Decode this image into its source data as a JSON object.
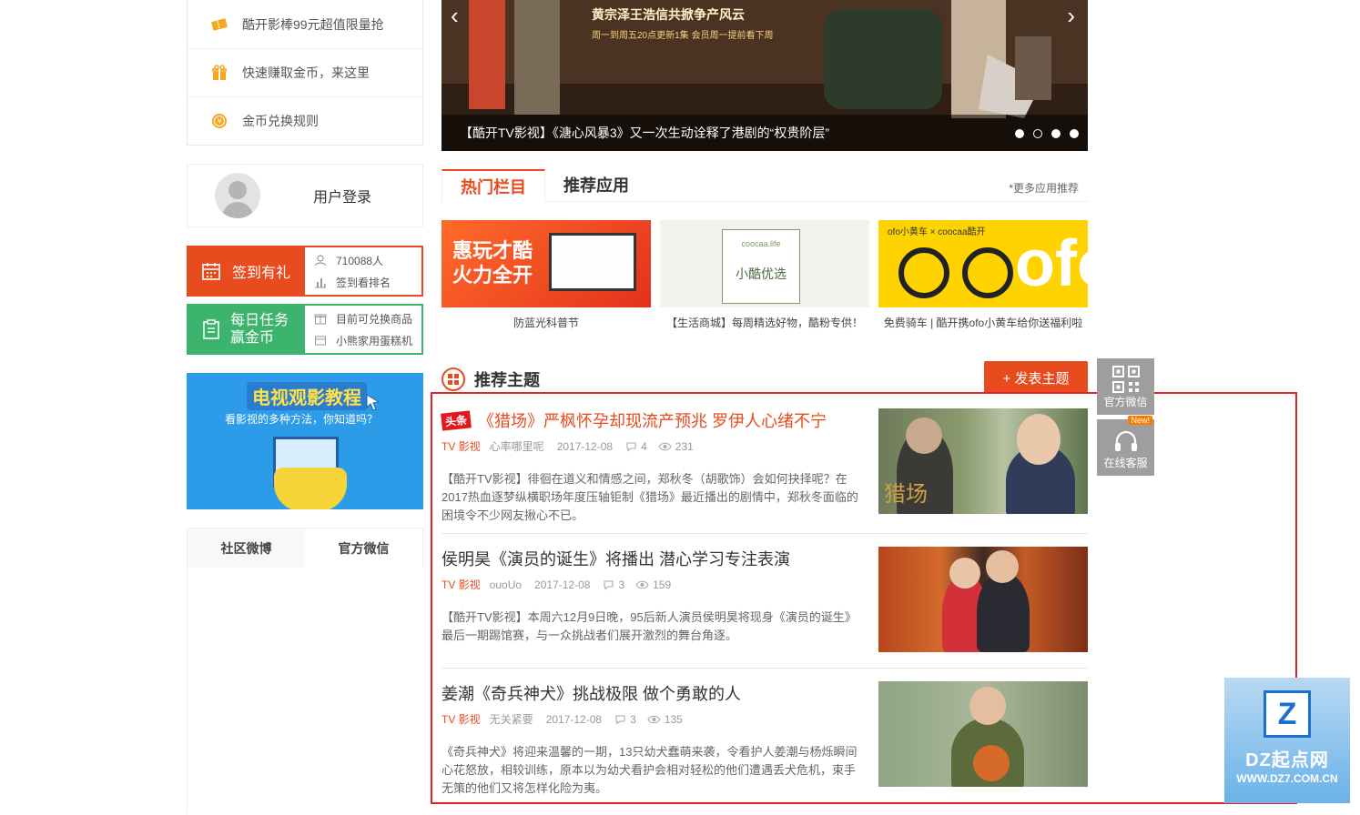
{
  "gifts": {
    "items": [
      {
        "label": "酷开影棒99元超值限量抢",
        "icon": "ticket-icon"
      },
      {
        "label": "快速赚取金币，来这里",
        "icon": "gift-icon"
      },
      {
        "label": "金币兑换规则",
        "icon": "coin-icon"
      }
    ]
  },
  "login": {
    "label": "用户登录"
  },
  "sign": {
    "label": "签到有礼",
    "count": "710088人",
    "rank": "签到看排名"
  },
  "task": {
    "line1": "每日任务",
    "line2": "赢金币",
    "item1": "目前可兑换商品",
    "item2": "小熊家用蛋糕机"
  },
  "tutorial": {
    "title": "电视观影教程",
    "subtitle": "看影视的多种方法，你知道吗？"
  },
  "social": {
    "tab1": "社区微博",
    "tab2": "官方微信"
  },
  "banner": {
    "headline": "黄宗泽王浩信共掀争产风云",
    "schedule": "周一到周五20点更新1集   会员周一提前看下周",
    "caption": "【酷开TV影视】《溏心风暴3》又一次生动诠释了港剧的“权贵阶层”"
  },
  "sections": {
    "tab_active": "热门栏目",
    "tab_other": "推荐应用",
    "more": "*更多应用推荐"
  },
  "apps": [
    {
      "label": "防蓝光科普节",
      "img_text1": "惠玩才酷",
      "img_text2": "火力全开"
    },
    {
      "label": "【生活商城】每周精选好物，酷粉专供！",
      "img_text1": "coocaa.life",
      "img_text2": "小酷优选"
    },
    {
      "label": "免费骑车 | 酷开携ofo小黄车给你送福利啦",
      "img_text1": "ofo小黄车 × coocaa酷开",
      "img_text2": "ofo"
    }
  ],
  "topics_head": {
    "title": "推荐主题",
    "post_button": "+ 发表主题"
  },
  "topics": [
    {
      "tag": "头条",
      "title": "《猎场》严枫怀孕却现流产预兆 罗伊人心绪不宁",
      "category": "TV 影视",
      "author": "心率哪里呢",
      "date": "2017-12-08",
      "replies": "4",
      "views": "231",
      "desc": "【酷开TV影视】徘徊在道义和情感之间，郑秋冬（胡歌饰）会如何抉择呢？在2017热血逐梦纵横职场年度压轴钜制《猎场》最近播出的剧情中，郑秋冬面临的困境令不少网友揪心不已。",
      "pic_text": "猎场"
    },
    {
      "title": "侯明昊《演员的诞生》将播出 潜心学习专注表演",
      "category": "TV 影视",
      "author": "ouoUo",
      "date": "2017-12-08",
      "replies": "3",
      "views": "159",
      "desc": "【酷开TV影视】本周六12月9日晚，95后新人演员侯明昊将现身《演员的诞生》最后一期踢馆赛，与一众挑战者们展开激烈的舞台角逐。"
    },
    {
      "title": "姜潮《奇兵神犬》挑战极限 做个勇敢的人",
      "category": "TV 影视",
      "author": "无关紧要",
      "date": "2017-12-08",
      "replies": "3",
      "views": "135",
      "desc": "《奇兵神犬》将迎来温馨的一期，13只幼犬蠢萌来袭，令看护人姜潮与杨烁瞬间心花怒放，相较训练，原本以为幼犬看护会相对轻松的他们遭遇丢犬危机，束手无策的他们又将怎样化险为夷。"
    }
  ],
  "float": {
    "wechat": "官方微信",
    "service": "在线客服",
    "new": "New!"
  },
  "watermark": {
    "logo": "Z",
    "brand": "DZ起点网",
    "url": "WWW.DZ7.COM.CN"
  },
  "colors": {
    "accent": "#e84b1e",
    "green": "#3db46d",
    "outline": "#e62129"
  }
}
